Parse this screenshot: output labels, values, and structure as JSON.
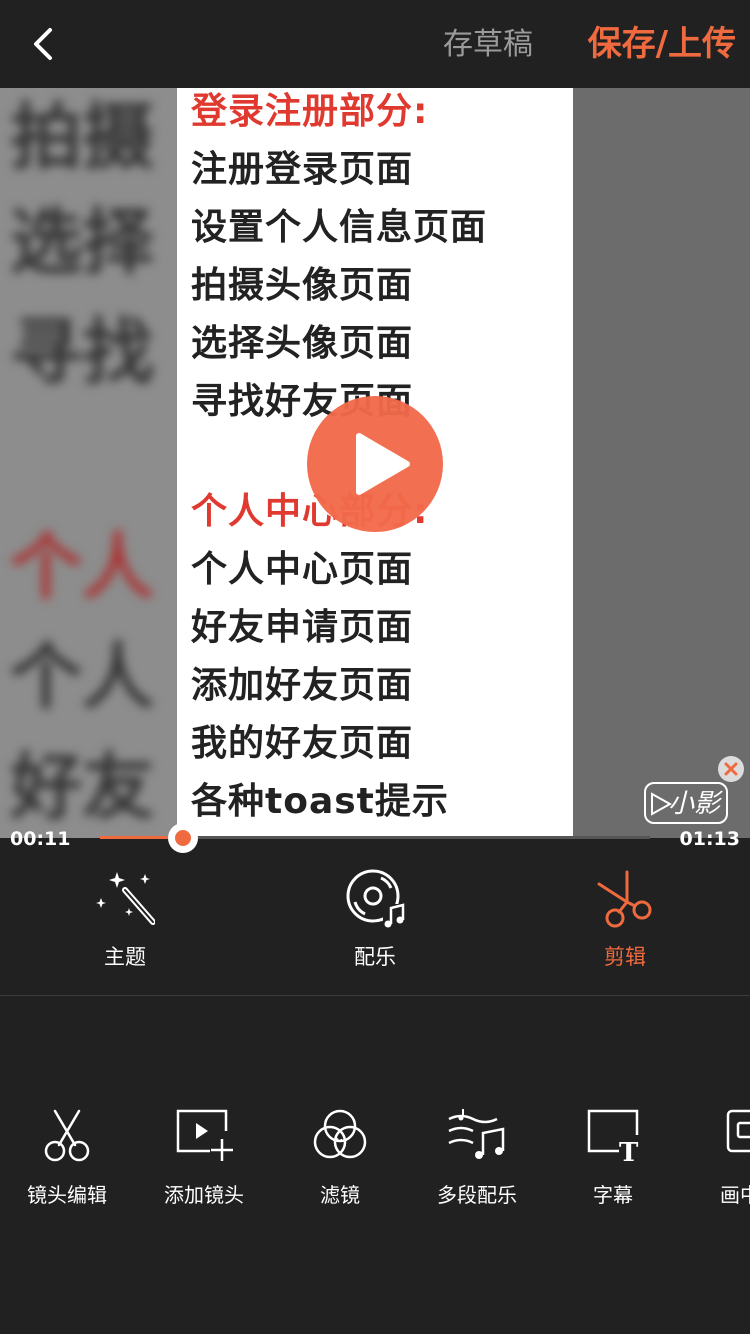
{
  "header": {
    "back_icon": "back-chevron-icon",
    "draft_label": "存草稿",
    "save_label": "保存/上传",
    "accent_color": "#f06a40"
  },
  "preview": {
    "blurred_left_text": [
      "拍摄",
      "选择",
      "寻找",
      "个人",
      "个人",
      "好友"
    ],
    "slide_lines": [
      {
        "text": "登录注册部分:",
        "color": "red"
      },
      {
        "text": "注册登录页面",
        "color": "dark"
      },
      {
        "text": "设置个人信息页面",
        "color": "dark"
      },
      {
        "text": "拍摄头像页面",
        "color": "dark"
      },
      {
        "text": "选择头像页面",
        "color": "dark"
      },
      {
        "text": "寻找好友页面",
        "color": "dark"
      },
      {
        "text": "个人中心部分:",
        "color": "red"
      },
      {
        "text": "个人中心页面",
        "color": "dark"
      },
      {
        "text": "好友申请页面",
        "color": "dark"
      },
      {
        "text": "添加好友页面",
        "color": "dark"
      },
      {
        "text": "我的好友页面",
        "color": "dark"
      },
      {
        "text": "各种toast提示",
        "color": "dark"
      }
    ],
    "play_icon": "play-icon",
    "watermark_text": "小影",
    "watermark_close_icon": "close-icon"
  },
  "progress": {
    "current_time": "00:11",
    "total_time": "01:13",
    "fraction": 0.15
  },
  "tabs": [
    {
      "label": "主题",
      "icon": "magic-wand-icon",
      "active": false
    },
    {
      "label": "配乐",
      "icon": "music-disc-icon",
      "active": false
    },
    {
      "label": "剪辑",
      "icon": "scissors-icon",
      "active": true
    }
  ],
  "tools": [
    {
      "label": "镜头编辑",
      "icon": "scissors-icon"
    },
    {
      "label": "添加镜头",
      "icon": "add-clip-icon"
    },
    {
      "label": "滤镜",
      "icon": "filter-circles-icon"
    },
    {
      "label": "多段配乐",
      "icon": "multi-music-icon"
    },
    {
      "label": "字幕",
      "icon": "subtitle-icon"
    },
    {
      "label": "画中",
      "icon": "picture-in-picture-icon"
    }
  ]
}
